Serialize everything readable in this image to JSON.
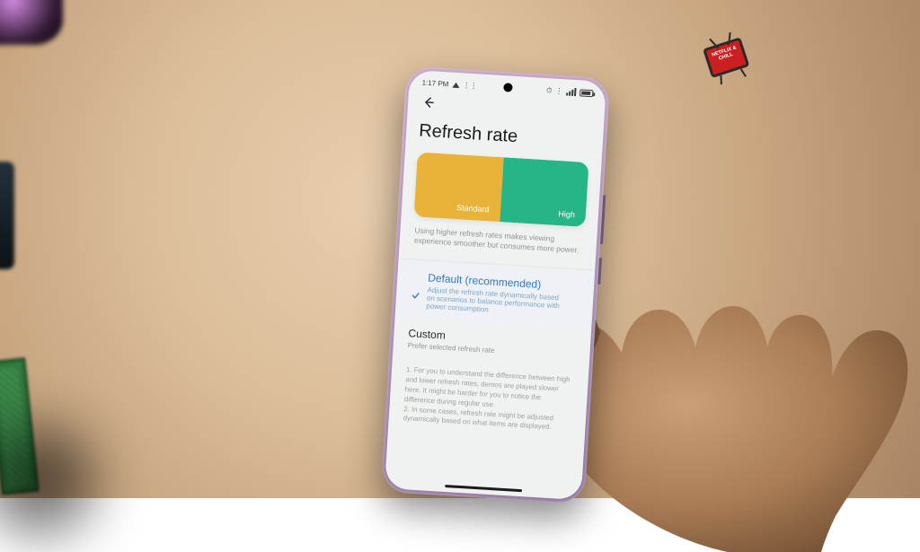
{
  "status": {
    "time": "1:17 PM",
    "sound_icon": "△"
  },
  "page_title": "Refresh rate",
  "segments": {
    "standard": "Standard",
    "high": "High"
  },
  "description": "Using higher refresh rates makes viewing experience smoother but consumes more power.",
  "options": {
    "default": {
      "title": "Default (recommended)",
      "desc": "Adjust the refresh rate dynamically based on scenarios to balance performance with power consumption"
    },
    "custom": {
      "title": "Custom",
      "desc": "Prefer selected refresh rate"
    }
  },
  "footnote": "1. For you to understand the difference between high and lower refresh rates, demos are played slower here. It might be harder for you to notice the difference during regular use.\n2. In some cases, refresh rate might be adjusted dynamically based on what items are displayed.",
  "sticker": "NETFLIX & CHILL"
}
